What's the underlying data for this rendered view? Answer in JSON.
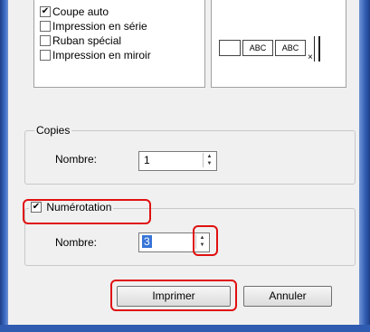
{
  "options": [
    {
      "label": "Coupe auto",
      "checked": true
    },
    {
      "label": "Impression en série",
      "checked": false
    },
    {
      "label": "Ruban spécial",
      "checked": false
    },
    {
      "label": "Impression en miroir",
      "checked": false
    }
  ],
  "preview": {
    "tag1": "ABC",
    "tag2": "ABC",
    "x_mark": "×"
  },
  "copies": {
    "legend": "Copies",
    "label": "Nombre:",
    "value": "1"
  },
  "numbering": {
    "checkbox_label": "Numérotation",
    "checked": true,
    "label": "Nombre:",
    "value": "3"
  },
  "buttons": {
    "print": "Imprimer",
    "cancel": "Annuler"
  },
  "check_glyph": "✔",
  "highlight_color": "#e01010"
}
